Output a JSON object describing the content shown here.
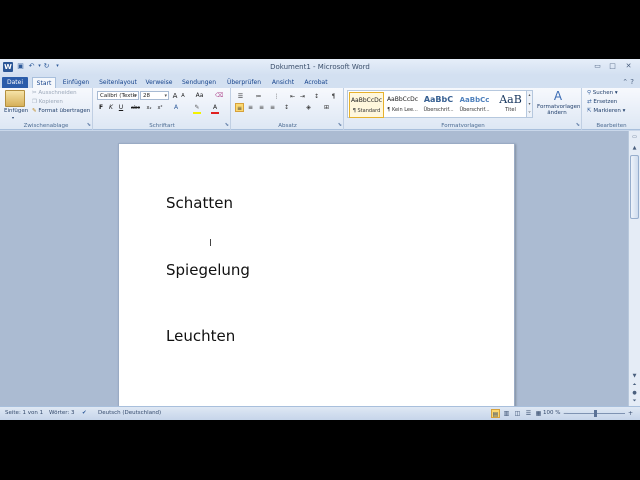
{
  "window": {
    "title": "Dokument1 - Microsoft Word",
    "app_icon": "W",
    "controls": [
      "▭",
      "□",
      "✕"
    ]
  },
  "quick_access": {
    "save_icon": "save-icon",
    "undo_icon": "undo-icon",
    "redo_icon": "redo-icon",
    "customize_icon": "dropdown-icon"
  },
  "tabs": [
    {
      "label": "Datei"
    },
    {
      "label": "Start"
    },
    {
      "label": "Einfügen"
    },
    {
      "label": "Seitenlayout"
    },
    {
      "label": "Verweise"
    },
    {
      "label": "Sendungen"
    },
    {
      "label": "Überprüfen"
    },
    {
      "label": "Ansicht"
    },
    {
      "label": "Acrobat"
    }
  ],
  "ribbon": {
    "clipboard": {
      "group_label": "Zwischenablage",
      "paste_label": "Einfügen",
      "cut_label": "Ausschneiden",
      "copy_label": "Kopieren",
      "format_painter_label": "Format übertragen"
    },
    "font": {
      "group_label": "Schriftart",
      "font_name": "Calibri (Textk",
      "font_size": "28",
      "grow": "A",
      "shrink": "A",
      "case": "Aa",
      "bold": "F",
      "italic": "K",
      "underline": "U",
      "strike": "abc",
      "subscript": "x₂",
      "superscript": "x²",
      "font_color": "A"
    },
    "paragraph": {
      "group_label": "Absatz",
      "pilcrow": "¶"
    },
    "styles": {
      "group_label": "Formatvorlagen",
      "items": [
        {
          "sample": "AaBbCcDc",
          "name": "¶ Standard"
        },
        {
          "sample": "AaBbCcDc",
          "name": "¶ Kein Lee..."
        },
        {
          "sample": "AaBbC",
          "name": "Überschrif..."
        },
        {
          "sample": "AaBbCc",
          "name": "Überschrif..."
        },
        {
          "sample": "AaB",
          "name": "Titel"
        }
      ],
      "change_styles_label_1": "Formatvorlagen",
      "change_styles_label_2": "ändern"
    },
    "editing": {
      "group_label": "Bearbeiten",
      "find_label": "Suchen",
      "replace_label": "Ersetzen",
      "select_label": "Markieren"
    }
  },
  "document": {
    "paragraphs": [
      "Schatten",
      "Spiegelung",
      "Leuchten"
    ]
  },
  "status": {
    "page": "Seite: 1 von 1",
    "words": "Wörter: 3",
    "language": "Deutsch (Deutschland)",
    "zoom": "100 %",
    "zoom_minus": "−",
    "zoom_plus": "+"
  },
  "colors": {
    "file_tab": "#2a5caa",
    "highlight": "#fbd870",
    "font_color_bar": "#e02020",
    "highlighter_bar": "#f3f200"
  }
}
